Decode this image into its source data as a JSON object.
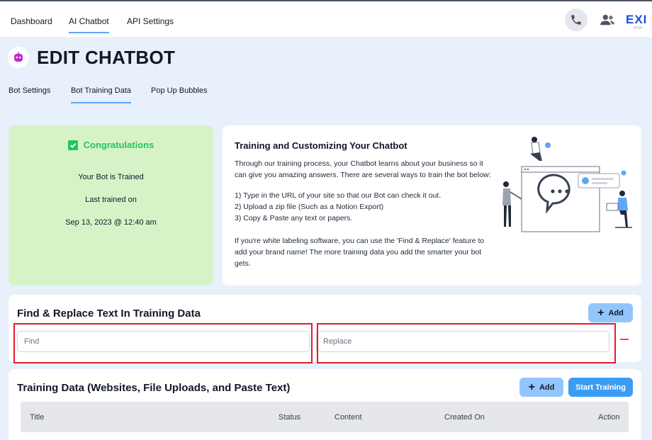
{
  "nav": {
    "items": [
      {
        "label": "Dashboard"
      },
      {
        "label": "AI Chatbot"
      },
      {
        "label": "API Settings"
      }
    ],
    "logo_text": "EXI",
    "logo_sub": "POW"
  },
  "page": {
    "title": "EDIT CHATBOT"
  },
  "tabs": [
    {
      "label": "Bot Settings"
    },
    {
      "label": "Bot Training Data"
    },
    {
      "label": "Pop Up Bubbles"
    }
  ],
  "congrats": {
    "title": "Congratulations",
    "status": "Your Bot is Trained",
    "last_trained_label": "Last trained on",
    "last_trained_date": "Sep 13, 2023 @ 12:40 am"
  },
  "info": {
    "title": "Training and Customizing Your Chatbot",
    "intro_1": "Through our training process, your Chatbot learns about your business so it",
    "intro_2": "can give you amazing answers. There are several ways to train the bot below:",
    "step_1": "1) Type in the URL of your site so that our Bot can check it out.",
    "step_2": "2) Upload a zip file (Such as a Notion Export)",
    "step_3": "3) Copy & Paste any text or papers.",
    "note_1": "If you're white labeling software, you can use the 'Find & Replace' feature to",
    "note_2": "add your brand name! The more training data you add the smarter your bot",
    "note_3": "gets."
  },
  "find_replace": {
    "title": "Find & Replace Text In Training Data",
    "add_label": "Add",
    "find_placeholder": "Find",
    "replace_placeholder": "Replace"
  },
  "training_data": {
    "title": "Training Data (Websites, File Uploads, and Paste Text)",
    "add_label": "Add",
    "start_label": "Start Training",
    "columns": [
      "Title",
      "Status",
      "Content",
      "Created On",
      "Action"
    ]
  },
  "colors": {
    "accent": "#3b9cf5",
    "success": "#22c55e",
    "highlight_frame": "#e11d2a",
    "remove": "#ef4444"
  }
}
